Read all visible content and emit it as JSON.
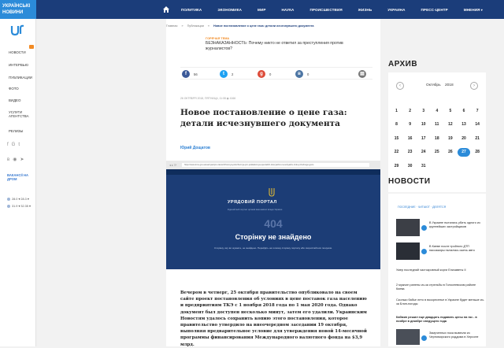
{
  "topnav": {
    "logo": "УКРАЇНСЬКІ НОВИНИ",
    "items": [
      "ПОЛИТИКА",
      "ЭКОНОМИКА",
      "МИР",
      "НАУКА",
      "ПРОИСШЕСТВИЯ",
      "ЖИЗНЬ",
      "УКРАИНА",
      "ПРЕСС-ЦЕНТР",
      "МНЕНИЯ"
    ]
  },
  "sidebar": {
    "items": [
      "НОВОСТИ",
      "ИНТЕРВЬЮ",
      "ПУБЛИКАЦИИ",
      "ФОТО",
      "ВИДЕО",
      "УСЛУГИ АГЕНТСТВА",
      "РЕЛИЗЫ"
    ],
    "promo": "ВАКАНСІЇ НА ДРОМ",
    "rates": [
      "28.0 ▾ 28.3 ▾",
      "31.9 ▾ 32.35 ▾"
    ]
  },
  "breadcrumb": {
    "home": "Главная",
    "section": "Публикации",
    "current": "Новое постановление о цене газа: детали исчезнувшего документа"
  },
  "hot": {
    "label": "ГОРЯЧАЯ ТЕМА",
    "text": "БЕЗНАКАЗАННОСТЬ: Почему никто не ответил за преступления против журналистов?"
  },
  "share": {
    "fb": "56",
    "tw": "2",
    "gp": "0",
    "vk": "0"
  },
  "article": {
    "meta": "26 ОКТЯБРЯ 2018, ПЯТНИЦА, 11:08   ◉ 4166",
    "title": "Новое постановление о цене газа: детали исчезнувшего документа",
    "author": "Юрий Дощатов",
    "body": "Вечером в четверг, 25 октября правительство опубликовало на своем сайте проект постановления об условиях в цене поставок газа населению и предприятиям ТКЭ с 1 ноября 2018 года по 1 мая 2020 года. Однако документ был доступен несколько минут, затем его удалили. Украинским Новостям удалось сохранить копию этого постановления, которое правительство утвердило на внеочередном заседании 19 октября, выполняя предварительное условие для утверждения новой 14-месячной программы финансирования Международного валютного фонда на $3,9 млрд."
  },
  "screenshot": {
    "url": "https://www.kmu.gov.ua/ua/npas/pro-zatverdzhennya-polozhennya-pro-pokladennya-specialnih-obovyazkiv-na-subyektiv-rinku-prirodnogo-gazu",
    "portal": "УРЯДОВИЙ ПОРТАЛ",
    "portal_sub": "Єдиний веб-портал органів виконавчої влади України",
    "code": "404",
    "notfound": "Сторінку не знайдено",
    "desc": "Сторінку, яку ви шукаєте, не знайдено. Перейдіть на головну сторінку порталу або скористайтеся пошуком."
  },
  "archive": {
    "heading": "АРХИВ",
    "month": "Октябрь",
    "year": "2018",
    "weeks": [
      [
        "1",
        "2",
        "3",
        "4",
        "5",
        "6",
        "7"
      ],
      [
        "8",
        "9",
        "10",
        "11",
        "12",
        "13",
        "14"
      ],
      [
        "15",
        "16",
        "17",
        "18",
        "19",
        "20",
        "21"
      ],
      [
        "22",
        "23",
        "24",
        "25",
        "26",
        "27",
        "28"
      ],
      [
        "29",
        "30",
        "31",
        "",
        "",
        "",
        ""
      ]
    ],
    "today": "27"
  },
  "news": {
    "heading": "НОВОСТИ",
    "tabs": "ПОСЛЕДНИЕ · ЧИТАЮТ · ДЕЛЯТСЯ",
    "featured": [
      "В Украине пытались убить одного из крупнейших застройщиков",
      "В Киеве после тройного ДТП пассажиры пытались сжечь авто"
    ],
    "list": [
      {
        "text": "Умер последний частокровный корги Елизаветы II",
        "bold": false
      },
      {
        "text": "2 мужчин ранены из-за стрельбы в Голосеевском районе Киева",
        "bold": false
      },
      {
        "text": "Сколько бабье лето в воскресенье в Украине будет меньше из-за Блин-погоды",
        "bold": false
      },
      {
        "text": "Кабмин решил еще двадцать подавать цены на газ - в ноябре в декабре сведущего года",
        "bold": true
      },
      {
        "text": "Замученных пока вывезли из Черноморского роддома в Херсоне",
        "bold": false
      }
    ]
  }
}
